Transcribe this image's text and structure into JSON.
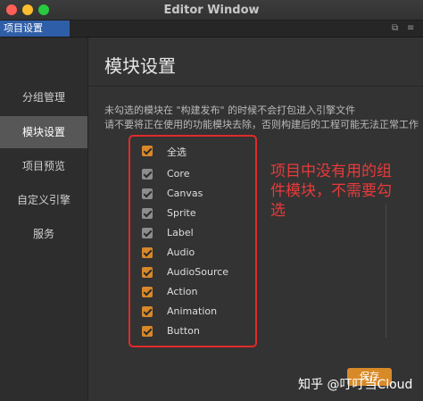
{
  "window": {
    "title": "Editor Window"
  },
  "tab": {
    "label": "项目设置"
  },
  "sidebar": {
    "items": [
      {
        "label": "分组管理",
        "active": false
      },
      {
        "label": "模块设置",
        "active": true
      },
      {
        "label": "项目预览",
        "active": false
      },
      {
        "label": "自定义引擎",
        "active": false
      },
      {
        "label": "服务",
        "active": false
      }
    ]
  },
  "main": {
    "heading": "模块设置",
    "desc_line1": "未勾选的模块在 \"构建发布\" 的时候不会打包进入引擎文件",
    "desc_line2": "请不要将正在使用的功能模块去除，否则构建后的工程可能无法正常工作",
    "modules": [
      {
        "label": "全选",
        "checked": true,
        "style": "accent"
      },
      {
        "label": "Core",
        "checked": true,
        "style": "dim"
      },
      {
        "label": "Canvas",
        "checked": true,
        "style": "dim"
      },
      {
        "label": "Sprite",
        "checked": true,
        "style": "dim"
      },
      {
        "label": "Label",
        "checked": true,
        "style": "dim"
      },
      {
        "label": "Audio",
        "checked": true,
        "style": "accent"
      },
      {
        "label": "AudioSource",
        "checked": true,
        "style": "accent"
      },
      {
        "label": "Action",
        "checked": true,
        "style": "accent"
      },
      {
        "label": "Animation",
        "checked": true,
        "style": "accent"
      },
      {
        "label": "Button",
        "checked": true,
        "style": "accent"
      }
    ],
    "save_label": "保存"
  },
  "annotation": {
    "text": "项目中没有用的组件模块，不需要勾选"
  },
  "watermark": {
    "text": "知乎 @叮叮当Cloud"
  },
  "colors": {
    "accent": "#d8882a",
    "tab_active": "#2f5ea8",
    "annotation": "#e02a2a"
  }
}
